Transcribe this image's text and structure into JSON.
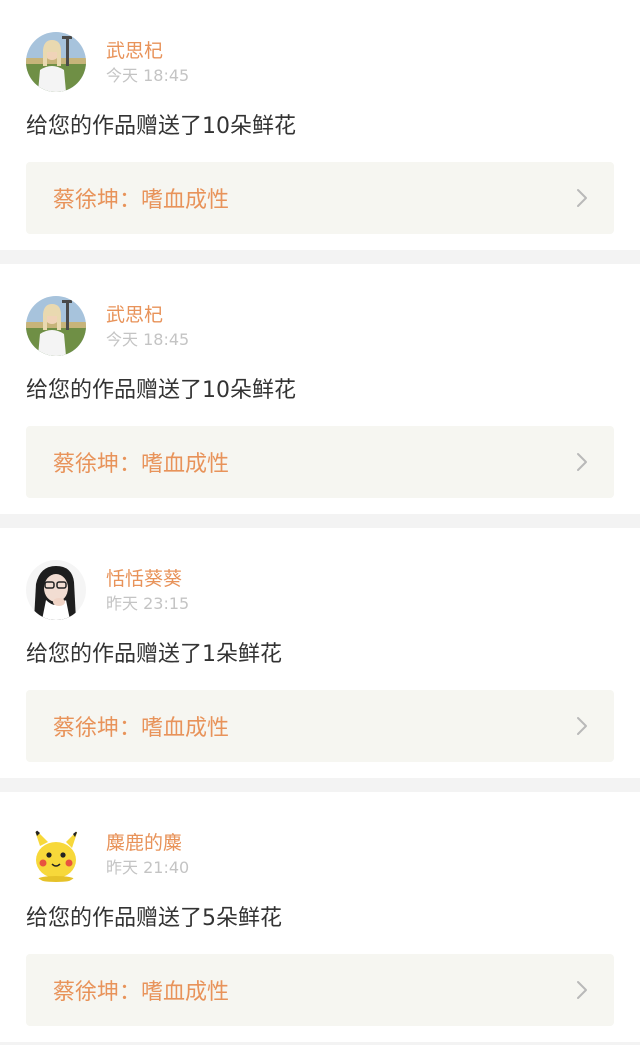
{
  "notifications": [
    {
      "user": "武思杞",
      "time": "今天 18:45",
      "avatar_icon": "girl-outdoor-avatar-icon",
      "message": "给您的作品赠送了10朵鲜花",
      "work": {
        "author": "蔡徐坤",
        "separator": "：",
        "title": "嗜血成性"
      }
    },
    {
      "user": "武思杞",
      "time": "今天 18:45",
      "avatar_icon": "girl-outdoor-avatar-icon",
      "message": "给您的作品赠送了10朵鲜花",
      "work": {
        "author": "蔡徐坤",
        "separator": "：",
        "title": "嗜血成性"
      }
    },
    {
      "user": "恬恬葵葵",
      "time": "昨天 23:15",
      "avatar_icon": "girl-glasses-avatar-icon",
      "message": "给您的作品赠送了1朵鲜花",
      "work": {
        "author": "蔡徐坤",
        "separator": "：",
        "title": "嗜血成性"
      }
    },
    {
      "user": "麋鹿的麋",
      "time": "昨天 21:40",
      "avatar_icon": "pikachu-avatar-icon",
      "message": "给您的作品赠送了5朵鲜花",
      "work": {
        "author": "蔡徐坤",
        "separator": "：",
        "title": "嗜血成性"
      }
    }
  ],
  "colors": {
    "accent": "#e8935a",
    "time_gray": "#c4c4c4",
    "text": "#333333",
    "link_bg": "#f6f6f1",
    "page_bg": "#f3f3f3"
  },
  "icons": {
    "chevron": "chevron-right-icon"
  }
}
